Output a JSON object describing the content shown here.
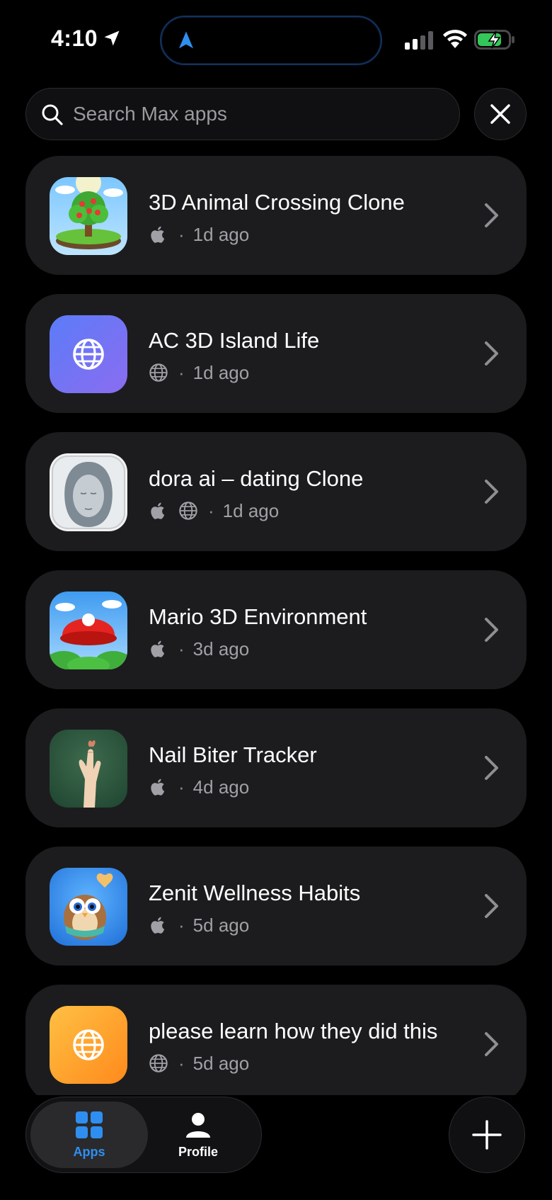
{
  "status_bar": {
    "time": "4:10"
  },
  "search": {
    "placeholder": "Search Max apps",
    "value": ""
  },
  "apps": [
    {
      "name": "3D Animal Crossing Clone",
      "platforms": [
        "apple"
      ],
      "age": "1d ago",
      "icon": "tree-island-icon"
    },
    {
      "name": "AC 3D Island Life",
      "platforms": [
        "web"
      ],
      "age": "1d ago",
      "icon": "globe-app-icon"
    },
    {
      "name": "dora ai – dating Clone",
      "platforms": [
        "apple",
        "web"
      ],
      "age": "1d ago",
      "icon": "face-sculpture-icon"
    },
    {
      "name": "Mario 3D Environment",
      "platforms": [
        "apple"
      ],
      "age": "3d ago",
      "icon": "red-cap-icon"
    },
    {
      "name": "Nail Biter Tracker",
      "platforms": [
        "apple"
      ],
      "age": "4d ago",
      "icon": "hand-icon"
    },
    {
      "name": "Zenit Wellness Habits",
      "platforms": [
        "apple"
      ],
      "age": "5d ago",
      "icon": "owl-icon"
    },
    {
      "name": "please learn how they did this",
      "platforms": [
        "web"
      ],
      "age": "5d ago",
      "icon": "globe-app-icon"
    }
  ],
  "meta_separator": "·",
  "tabs": [
    {
      "label": "Apps",
      "icon": "grid-icon",
      "active": true
    },
    {
      "label": "Profile",
      "icon": "person-icon",
      "active": false
    }
  ],
  "colors": {
    "accent": "#2f8ff0",
    "card": "#1c1c1e",
    "background": "#000000",
    "battery": "#34c759"
  }
}
